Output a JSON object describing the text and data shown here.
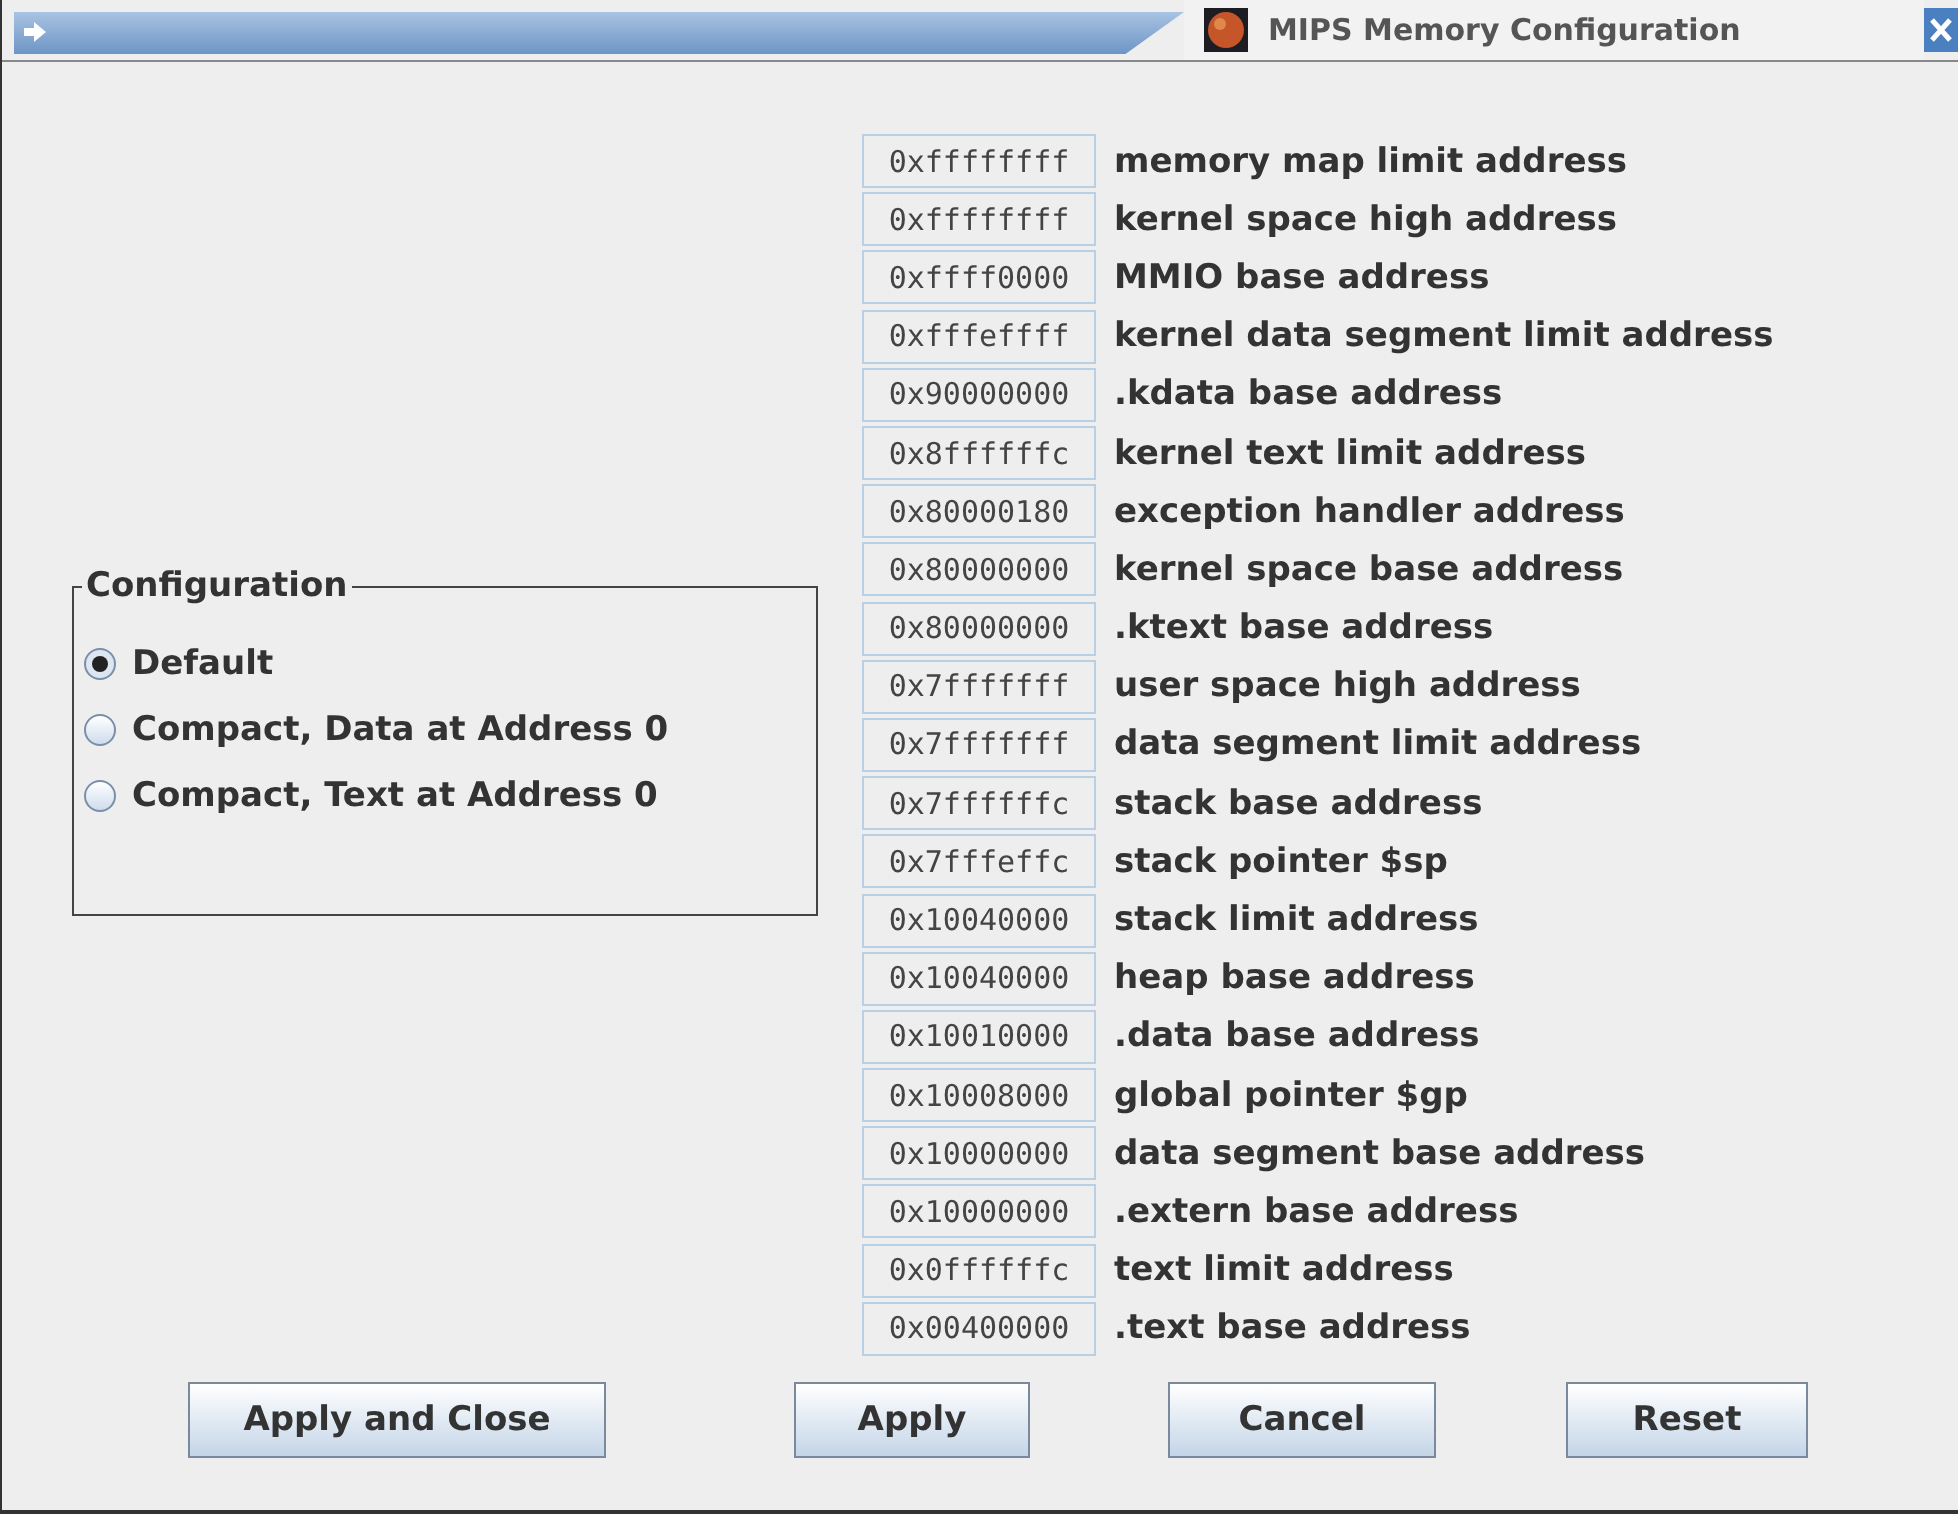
{
  "window": {
    "title": "MIPS Memory Configuration"
  },
  "configuration": {
    "title": "Configuration",
    "options": [
      {
        "label": "Default",
        "selected": true
      },
      {
        "label": "Compact, Data at Address 0",
        "selected": false
      },
      {
        "label": "Compact, Text at Address 0",
        "selected": false
      }
    ]
  },
  "addresses": [
    {
      "value": "0xffffffff",
      "label": "memory map limit address"
    },
    {
      "value": "0xffffffff",
      "label": "kernel space high address"
    },
    {
      "value": "0xffff0000",
      "label": "MMIO base address"
    },
    {
      "value": "0xfffeffff",
      "label": "kernel data segment limit address"
    },
    {
      "value": "0x90000000",
      "label": ".kdata base address"
    },
    {
      "value": "0x8ffffffc",
      "label": "kernel text limit address"
    },
    {
      "value": "0x80000180",
      "label": "exception handler address"
    },
    {
      "value": "0x80000000",
      "label": "kernel space base address"
    },
    {
      "value": "0x80000000",
      "label": ".ktext base address"
    },
    {
      "value": "0x7fffffff",
      "label": "user space high address"
    },
    {
      "value": "0x7fffffff",
      "label": "data segment limit address"
    },
    {
      "value": "0x7ffffffc",
      "label": "stack base address"
    },
    {
      "value": "0x7fffeffc",
      "label": "stack pointer $sp"
    },
    {
      "value": "0x10040000",
      "label": "stack limit address"
    },
    {
      "value": "0x10040000",
      "label": "heap base address"
    },
    {
      "value": "0x10010000",
      "label": ".data base address"
    },
    {
      "value": "0x10008000",
      "label": "global pointer $gp"
    },
    {
      "value": "0x10000000",
      "label": "data segment base address"
    },
    {
      "value": "0x10000000",
      "label": ".extern base address"
    },
    {
      "value": "0x0ffffffc",
      "label": "text limit address"
    },
    {
      "value": "0x00400000",
      "label": ".text base address"
    }
  ],
  "buttons": [
    "Apply and Close",
    "Apply",
    "Cancel",
    "Reset"
  ]
}
